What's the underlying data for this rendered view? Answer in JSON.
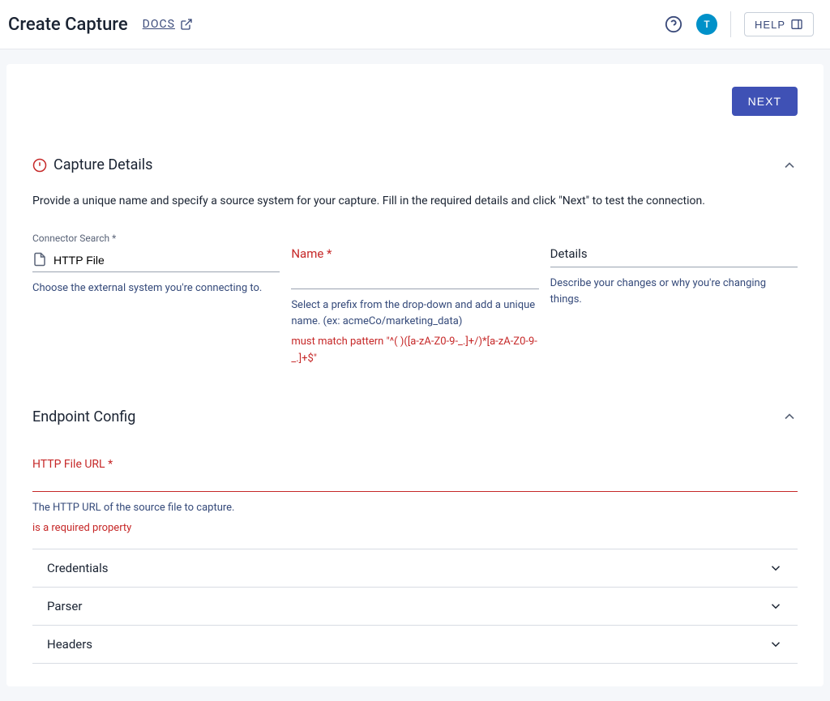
{
  "header": {
    "title": "Create Capture",
    "docs_label": "DOCS",
    "avatar_initial": "T",
    "help_label": "HELP"
  },
  "actions": {
    "next_label": "NEXT"
  },
  "capture_details": {
    "title": "Capture Details",
    "description": "Provide a unique name and specify a source system for your capture. Fill in the required details and click \"Next\" to test the connection.",
    "connector": {
      "label": "Connector Search *",
      "value": "HTTP File",
      "help": "Choose the external system you're connecting to."
    },
    "name": {
      "label": "Name *",
      "help": "Select a prefix from the drop-down and add a unique name. (ex: acmeCo/marketing_data)",
      "error": "must match pattern \"^(          )([a-zA-Z0-9-_.]+/)*[a-zA-Z0-9-_.]+$\""
    },
    "details": {
      "label": "Details",
      "help": "Describe your changes or why you're changing things."
    }
  },
  "endpoint_config": {
    "title": "Endpoint Config",
    "url": {
      "label": "HTTP File URL *",
      "help": "The HTTP URL of the source file to capture.",
      "error": "is a required property"
    },
    "sections": [
      {
        "label": "Credentials"
      },
      {
        "label": "Parser"
      },
      {
        "label": "Headers"
      }
    ]
  }
}
